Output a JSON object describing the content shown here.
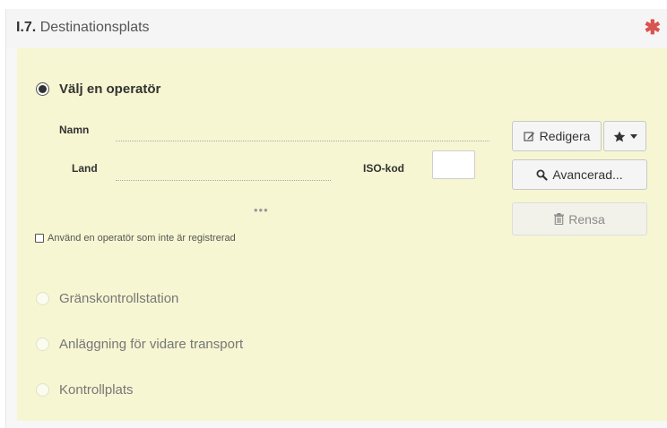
{
  "section": {
    "number": "I.7.",
    "title": "Destinationsplats",
    "required_mark": "✱"
  },
  "options": {
    "operator": "Välj en operatör",
    "border_station": "Gränskontrollstation",
    "onward_transport": "Anläggning för vidare transport",
    "control_point": "Kontrollplats"
  },
  "fields": {
    "name_label": "Namn",
    "name_value": "",
    "country_label": "Land",
    "country_value": "",
    "iso_label": "ISO-kod",
    "iso_value": ""
  },
  "more": "•••",
  "unregistered": "Använd en operatör som inte är registrerad",
  "buttons": {
    "edit": "Redigera",
    "advanced": "Avancerad...",
    "clear": "Rensa"
  },
  "icons": {
    "edit": "edit-icon",
    "favorites": "star-icon",
    "advanced": "search-icon",
    "clear": "trash-icon"
  },
  "colors": {
    "body_bg": "#f6f6d2",
    "required": "#d9534f"
  }
}
